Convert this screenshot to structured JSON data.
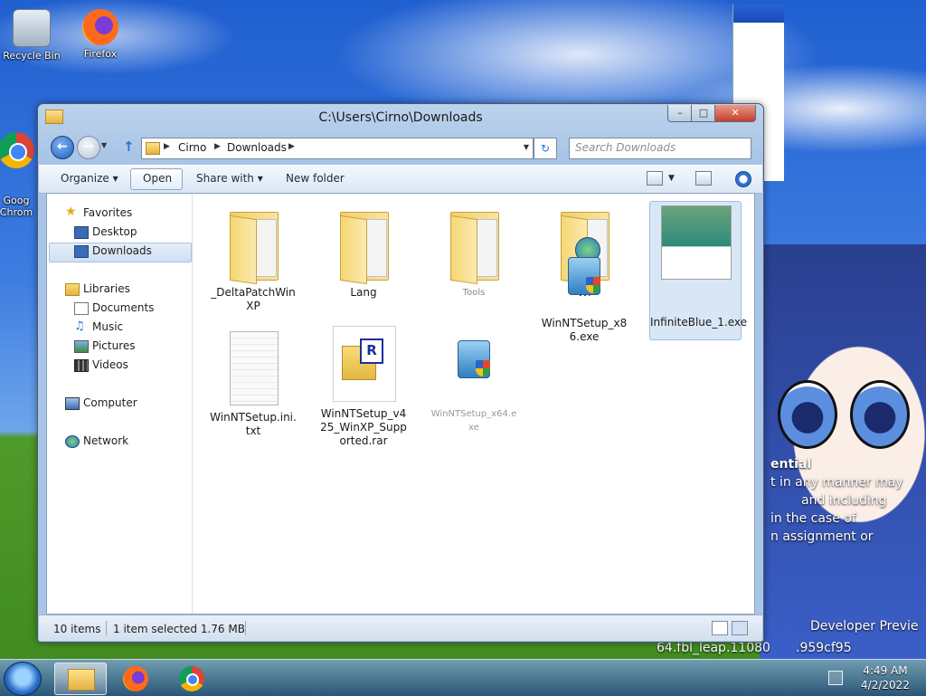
{
  "desktop": {
    "icons": [
      {
        "label": "Recycle Bin",
        "icon": "recycle-bin-icon"
      },
      {
        "label": "Firefox",
        "icon": "firefox-icon"
      },
      {
        "label": "Goog\nChrom",
        "icon": "chrome-icon"
      }
    ],
    "wallpaper_text": [
      "ential",
      "t in any manner may",
      "and including",
      "in the case of",
      "n assignment or",
      "Developer Previe",
      "64.fbl_leap.11080",
      ".959cf95"
    ]
  },
  "window": {
    "title": "C:\\Users\\Cirno\\Downloads",
    "controls": {
      "minimize": "–",
      "maximize": "□",
      "close": "✕"
    },
    "breadcrumb": [
      "Cirno",
      "Downloads"
    ],
    "search_placeholder": "Search Downloads",
    "toolbar": {
      "organize": "Organize",
      "open": "Open",
      "share_with": "Share with",
      "new_folder": "New folder"
    },
    "nav": {
      "favorites": "Favorites",
      "desktop": "Desktop",
      "downloads": "Downloads",
      "libraries": "Libraries",
      "documents": "Documents",
      "music": "Music",
      "pictures": "Pictures",
      "videos": "Videos",
      "computer": "Computer",
      "network": "Network"
    },
    "files": [
      {
        "name": "_DeltaPatchWinXP",
        "type": "folder"
      },
      {
        "name": "Lang",
        "type": "folder"
      },
      {
        "name": "Tools",
        "type": "folder"
      },
      {
        "name": "Wi",
        "type": "folder"
      },
      {
        "name": "InfiniteBlue_1.exe",
        "type": "exe",
        "selected": true
      },
      {
        "name": "WinNTSetup.ini.txt",
        "type": "txt"
      },
      {
        "name": "WinNTSetup_v425_WinXP_Supported.rar",
        "type": "rar"
      },
      {
        "name": "WinNTSetup_x64.exe",
        "type": "exe"
      },
      {
        "name": "WinNTSetup_x86.exe",
        "type": "exe"
      }
    ],
    "status": {
      "count": "10 items",
      "selection": "1 item selected  1.76 MB"
    }
  },
  "taskbar": {
    "time": "4:49 AM",
    "date": "4/2/2022"
  }
}
